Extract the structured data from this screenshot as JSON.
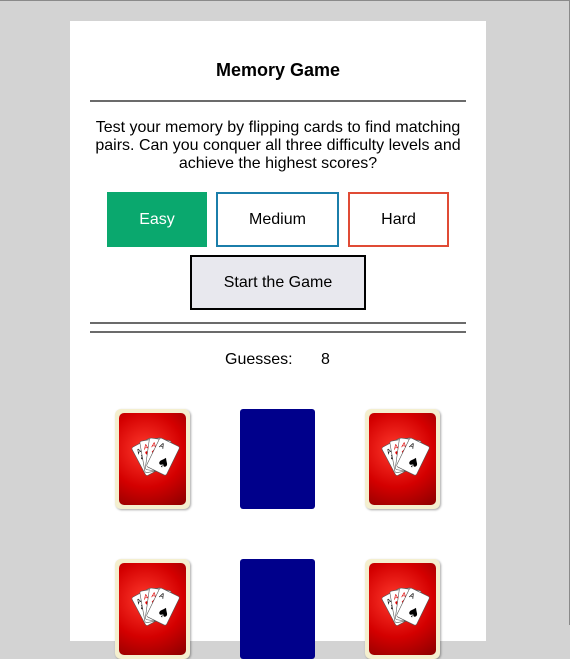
{
  "title": "Memory Game",
  "intro": "Test your memory by flipping cards to find matching pairs. Can you conquer all three difficulty levels and achieve the highest scores?",
  "difficulty": {
    "easy_label": "Easy",
    "medium_label": "Medium",
    "hard_label": "Hard",
    "selected": "Easy"
  },
  "start_label": "Start the Game",
  "guesses": {
    "label": "Guesses:",
    "value": "8"
  },
  "colors": {
    "easy": "#0aa86e",
    "medium_border": "#1b7eaa",
    "hard_border": "#e04b35",
    "card_back": "#00008b",
    "card_face": "#d40000"
  },
  "cards": [
    {
      "state": "face-down",
      "icon": "aces-fan-icon"
    },
    {
      "state": "revealed",
      "icon": "card-back"
    },
    {
      "state": "face-down",
      "icon": "aces-fan-icon"
    },
    {
      "state": "face-down",
      "icon": "aces-fan-icon"
    },
    {
      "state": "revealed",
      "icon": "card-back"
    },
    {
      "state": "face-down",
      "icon": "aces-fan-icon"
    }
  ]
}
